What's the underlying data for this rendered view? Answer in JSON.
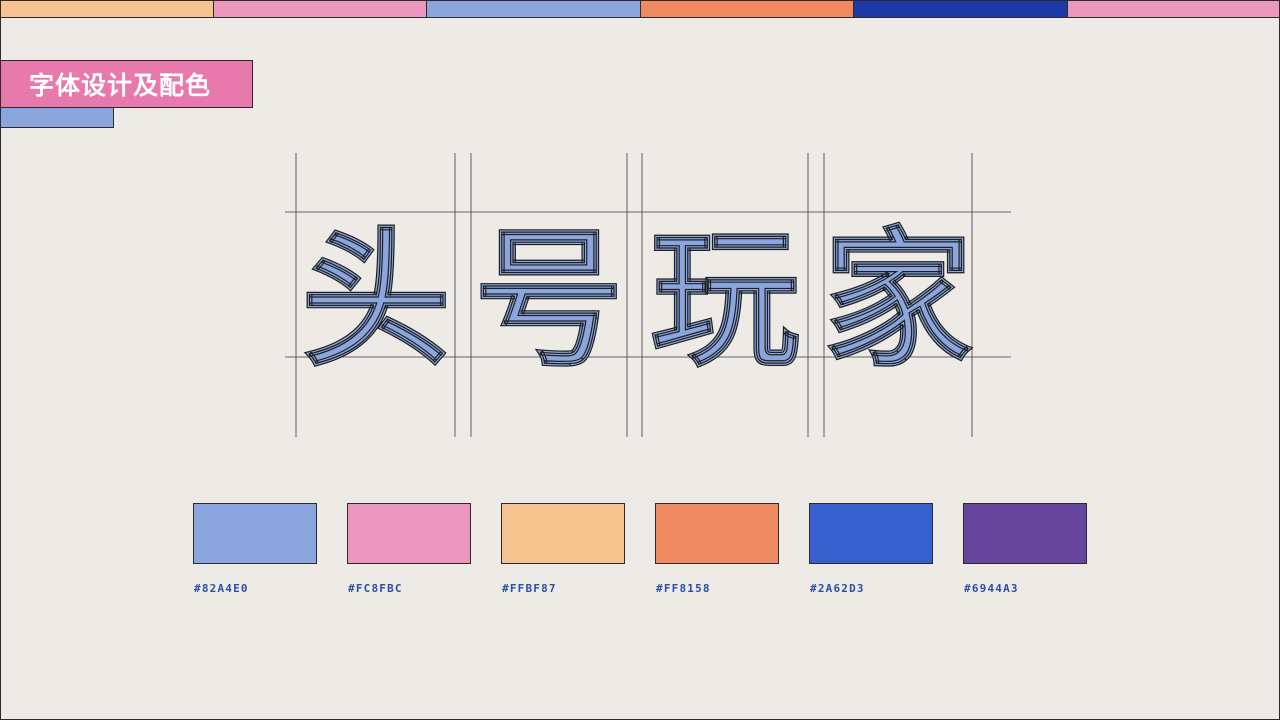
{
  "top_bar": {
    "colors": [
      "#F6C48E",
      "#EC97BD",
      "#8BA6DE",
      "#F0895F",
      "#1C3AA6",
      "#EC97BD"
    ]
  },
  "title": {
    "text": "字体设计及配色",
    "bg_color": "#E879AC",
    "accent_color": "#8BA6DE"
  },
  "logo": {
    "characters": [
      "头",
      "号",
      "玩",
      "家"
    ],
    "fill_color": "#8BA6DE"
  },
  "palette": [
    {
      "label": "#82A4E0",
      "color": "#8BA6DE"
    },
    {
      "label": "#FC8FBC",
      "color": "#EC95BD"
    },
    {
      "label": "#FFBF87",
      "color": "#F6C48E"
    },
    {
      "label": "#FF8158",
      "color": "#F08A60"
    },
    {
      "label": "#2A62D3",
      "color": "#3660CD"
    },
    {
      "label": "#6944A3",
      "color": "#65469C"
    }
  ]
}
